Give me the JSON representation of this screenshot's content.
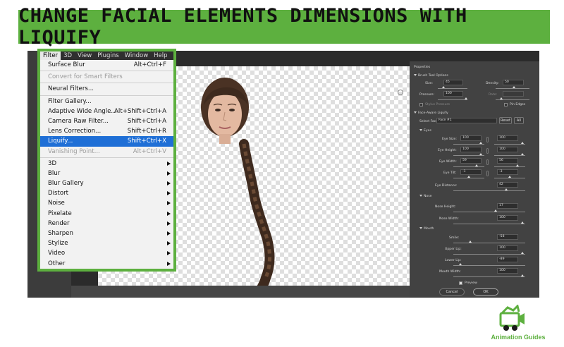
{
  "banner": {
    "title": "CHANGE FACIAL ELEMENTS  DIMENSIONS WITH LIQUIFY"
  },
  "menubar": [
    "Filter",
    "3D",
    "View",
    "Plugins",
    "Window",
    "Help"
  ],
  "filter_menu": {
    "items": [
      {
        "label": "Surface Blur",
        "shortcut": "Alt+Ctrl+F"
      },
      {
        "sep": true
      },
      {
        "label": "Convert for Smart Filters",
        "disabled": true
      },
      {
        "sep": true
      },
      {
        "label": "Neural Filters..."
      },
      {
        "sep": true
      },
      {
        "label": "Filter Gallery..."
      },
      {
        "label": "Adaptive Wide Angle...",
        "shortcut": "Alt+Shift+Ctrl+A"
      },
      {
        "label": "Camera Raw Filter...",
        "shortcut": "Shift+Ctrl+A"
      },
      {
        "label": "Lens Correction...",
        "shortcut": "Shift+Ctrl+R"
      },
      {
        "label": "Liquify...",
        "shortcut": "Shift+Ctrl+X",
        "selected": true
      },
      {
        "label": "Vanishing Point...",
        "shortcut": "Alt+Ctrl+V",
        "disabled": true
      },
      {
        "sep": true
      },
      {
        "label": "3D",
        "submenu": true
      },
      {
        "label": "Blur",
        "submenu": true
      },
      {
        "label": "Blur Gallery",
        "submenu": true
      },
      {
        "label": "Distort",
        "submenu": true
      },
      {
        "label": "Noise",
        "submenu": true
      },
      {
        "label": "Pixelate",
        "submenu": true
      },
      {
        "label": "Render",
        "submenu": true
      },
      {
        "label": "Sharpen",
        "submenu": true
      },
      {
        "label": "Stylize",
        "submenu": true
      },
      {
        "label": "Video",
        "submenu": true
      },
      {
        "label": "Other",
        "submenu": true
      }
    ]
  },
  "properties": {
    "title": "Properties",
    "brush_tool_options": {
      "heading": "Brush Tool Options",
      "size_label": "Size:",
      "size": "45",
      "density_label": "Density:",
      "density": "50",
      "pressure_label": "Pressure:",
      "pressure": "100",
      "rate_label": "Rate:",
      "stylus_pressure": "Stylus Pressure",
      "pin_edges": "Pin Edges"
    },
    "face_aware": {
      "heading": "Face-Aware Liquify",
      "select_face_label": "Select Face:",
      "select_face_value": "Face #1",
      "reset": "Reset",
      "all": "All"
    },
    "eyes": {
      "heading": "Eyes",
      "eye_size_label": "Eye Size:",
      "eye_size": [
        "100",
        "100"
      ],
      "eye_height_label": "Eye Height:",
      "eye_height": [
        "100",
        "100"
      ],
      "eye_width_label": "Eye Width:",
      "eye_width": [
        "59",
        "56"
      ],
      "eye_tilt_label": "Eye Tilt:",
      "eye_tilt": [
        "-1",
        "-3"
      ],
      "eye_distance_label": "Eye Distance:",
      "eye_distance": "42"
    },
    "nose": {
      "heading": "Nose",
      "nose_height_label": "Nose Height:",
      "nose_height": "17",
      "nose_width_label": "Nose Width:",
      "nose_width": "100"
    },
    "mouth": {
      "heading": "Mouth",
      "smile_label": "Smile:",
      "smile": "-58",
      "upper_lip_label": "Upper Lip:",
      "upper_lip": "100",
      "lower_lip_label": "Lower Lip:",
      "lower_lip": "-89",
      "mouth_width_label": "Mouth Width:",
      "mouth_width": "100"
    },
    "preview": "Preview",
    "cancel": "Cancel",
    "ok": "OK"
  },
  "logo": {
    "text": "Animation Guides"
  },
  "colors": {
    "brand_green": "#5db03f",
    "menu_highlight": "#1f6fd6",
    "panel_bg": "#424242"
  }
}
